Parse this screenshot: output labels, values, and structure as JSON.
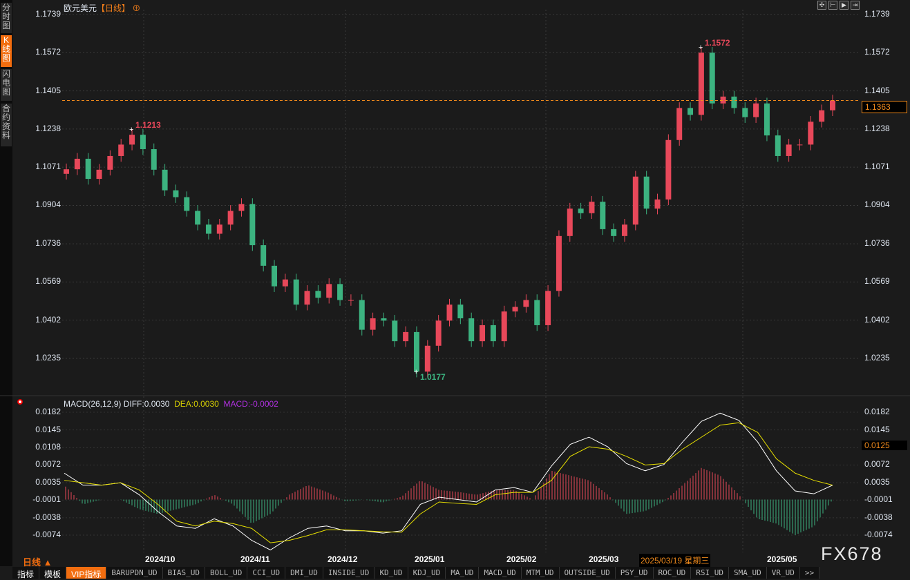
{
  "sidebar": {
    "tabs": [
      {
        "label": "分时图"
      },
      {
        "label": "K线图",
        "active": true
      },
      {
        "label": "闪电图"
      },
      {
        "label": "合约资料"
      }
    ]
  },
  "header": {
    "symbol": "欧元美元",
    "period": "【日线】",
    "toolbar_icons": [
      "crosshair-icon",
      "fit-axis-icon",
      "play-icon",
      "exit-icon"
    ]
  },
  "price_axis": {
    "ticks": [
      "1.1739",
      "1.1572",
      "1.1405",
      "1.1238",
      "1.1071",
      "1.0904",
      "1.0736",
      "1.0569",
      "1.0402",
      "1.0235"
    ],
    "current": "1.1363"
  },
  "annotations": {
    "high": "1.1572",
    "low": "1.0177",
    "local_high": "1.1213"
  },
  "macd_header": {
    "label": "MACD(26,12,9)",
    "diff": "DIFF:0.0030",
    "dea": "DEA:0.0030",
    "macd": "MACD:-0.0002"
  },
  "macd_axis": {
    "ticks": [
      "0.0182",
      "0.0145",
      "0.0108",
      "0.0072",
      "0.0035",
      "-0.0001",
      "-0.0038",
      "-0.0074"
    ],
    "current": "0.0125"
  },
  "x_axis": {
    "ticks": [
      "2024/10",
      "2024/11",
      "2024/12",
      "2025/01",
      "2025/02",
      "2025/03",
      "2025/05"
    ],
    "crosshair_date": "2025/03/19 星期三"
  },
  "period_label": "日线 ▲",
  "watermark": "FX678",
  "bottom_tabs": [
    "指标",
    "模板",
    "VIP指标",
    "BARUPDN_UD",
    "BIAS_UD",
    "BOLL_UD",
    "CCI_UD",
    "DMI_UD",
    "INSIDE_UD",
    "KD_UD",
    "KDJ_UD",
    "MA_UD",
    "MACD_UD",
    "MTM_UD",
    "OUTSIDE_UD",
    "PSY_UD",
    "ROC_UD",
    "RSI_UD",
    "SMA_UD",
    "VR_UD",
    ">>"
  ],
  "colors": {
    "up": "#e8485a",
    "down": "#3cb380",
    "diff": "#ffffff",
    "dea": "#e8e000",
    "accent": "#f26d0f",
    "macd_label": "#b030e0"
  },
  "chart_data": [
    {
      "type": "candlestick",
      "ylim": [
        1.0177,
        1.1739
      ],
      "last": 1.1363,
      "closes": [
        1.1062,
        1.1108,
        1.102,
        1.106,
        1.112,
        1.117,
        1.1213,
        1.115,
        1.106,
        1.097,
        1.094,
        1.088,
        1.082,
        1.078,
        1.082,
        1.088,
        1.091,
        1.073,
        1.064,
        1.055,
        1.058,
        1.047,
        1.053,
        1.05,
        1.056,
        1.049,
        1.049,
        1.036,
        1.041,
        1.04,
        1.031,
        1.035,
        1.0177,
        1.029,
        1.04,
        1.047,
        1.041,
        1.031,
        1.038,
        1.031,
        1.044,
        1.046,
        1.049,
        1.038,
        1.053,
        1.077,
        1.089,
        1.087,
        1.092,
        1.08,
        1.077,
        1.082,
        1.103,
        1.089,
        1.093,
        1.119,
        1.133,
        1.13,
        1.1572,
        1.135,
        1.138,
        1.133,
        1.129,
        1.135,
        1.121,
        1.112,
        1.117,
        1.117,
        1.127,
        1.132,
        1.1363
      ]
    },
    {
      "type": "line",
      "ylim": [
        -0.0105,
        0.0182
      ],
      "series": [
        {
          "name": "DIFF",
          "values": [
            0.0055,
            0.003,
            0.003,
            0.0035,
            0.001,
            -0.0025,
            -0.0055,
            -0.006,
            -0.004,
            -0.0055,
            -0.0085,
            -0.0105,
            -0.008,
            -0.006,
            -0.0055,
            -0.0065,
            -0.0065,
            -0.007,
            -0.0065,
            -0.001,
            0.0005,
            0,
            -0.0005,
            0.002,
            0.0025,
            0.0015,
            0.007,
            0.0115,
            0.013,
            0.011,
            0.0075,
            0.006,
            0.0073,
            0.012,
            0.0163,
            0.018,
            0.0165,
            0.012,
            0.006,
            0.0018,
            0.0012,
            0.003
          ]
        },
        {
          "name": "DEA",
          "values": [
            0.004,
            0.0035,
            0.003,
            0.0035,
            0.002,
            -0.001,
            -0.0045,
            -0.0055,
            -0.0045,
            -0.005,
            -0.006,
            -0.009,
            -0.0085,
            -0.0075,
            -0.0063,
            -0.0063,
            -0.0065,
            -0.0067,
            -0.0068,
            -0.003,
            -0.0005,
            -0.0008,
            -0.001,
            0.001,
            0.0015,
            0.0015,
            0.004,
            0.009,
            0.011,
            0.0105,
            0.009,
            0.0072,
            0.0075,
            0.0105,
            0.013,
            0.0155,
            0.016,
            0.014,
            0.0085,
            0.0055,
            0.004,
            0.003
          ]
        }
      ]
    }
  ]
}
